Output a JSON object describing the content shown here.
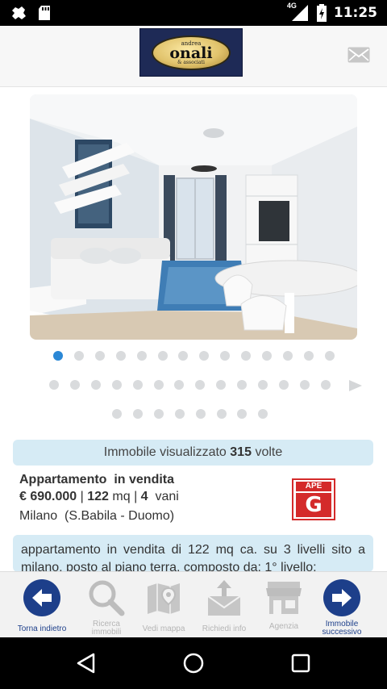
{
  "status_bar": {
    "network": "4G",
    "time": "11:25"
  },
  "header": {
    "logo": {
      "top": "andrea",
      "main": "onali",
      "bottom": "& associati"
    }
  },
  "gallery": {
    "image": "apartment-interior-photo",
    "dots_row1_count": 14,
    "dots_row2_count": 14,
    "dots_row3_count": 8,
    "active_index": 0
  },
  "views": {
    "prefix": "Immobile visualizzato",
    "count": "315",
    "suffix": "volte"
  },
  "listing": {
    "type": "Appartamento",
    "status": "in vendita",
    "price": "€ 690.000",
    "area_value": "122",
    "area_unit": "mq",
    "rooms_value": "4",
    "rooms_unit": "vani",
    "city": "Milano",
    "zone": "(S.Babila - Duomo)",
    "ape": {
      "title": "APE",
      "class": "G"
    }
  },
  "description": "appartamento in vendita di 122 mq ca. su 3 livelli sito a milano, posto al piano terra, composto da: 1° livello:",
  "toolbar": {
    "back": "Torna indietro",
    "search_line1": "Ricerca",
    "search_line2": "immobili",
    "map": "Vedi mappa",
    "info": "Richiedi info",
    "agency": "Agenzia",
    "next_line1": "Immobile",
    "next_line2": "successivo"
  },
  "colors": {
    "accent_blue": "#1d3f8a",
    "dot_active": "#2b88d6",
    "panel_bg": "#d6ebf5",
    "ape_red": "#d42a2a"
  }
}
